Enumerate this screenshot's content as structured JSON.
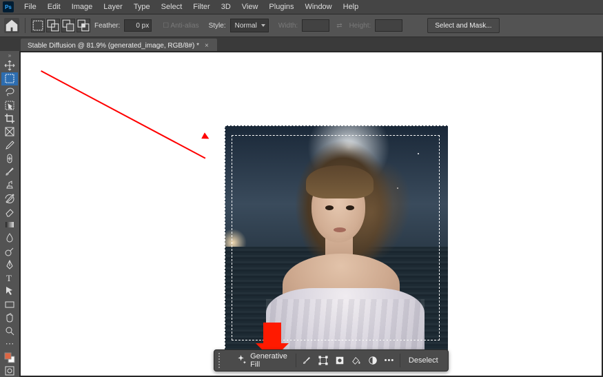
{
  "menubar": {
    "items": [
      "File",
      "Edit",
      "Image",
      "Layer",
      "Type",
      "Select",
      "Filter",
      "3D",
      "View",
      "Plugins",
      "Window",
      "Help"
    ]
  },
  "optbar": {
    "feather_label": "Feather:",
    "feather_value": "0 px",
    "antialias_label": "Anti-alias",
    "style_label": "Style:",
    "style_value": "Normal",
    "width_label": "Width:",
    "height_label": "Height:",
    "select_mask_label": "Select and Mask..."
  },
  "tab": {
    "title": "Stable Diffusion @ 81.9% (generated_image, RGB/8#) *"
  },
  "ctx": {
    "genfill": "Generative Fill",
    "deselect": "Deselect"
  },
  "icons": {
    "home": "home-icon",
    "new": "new-selection-icon",
    "add": "add-selection-icon",
    "sub": "subtract-selection-icon",
    "intersect": "intersect-selection-icon",
    "swap": "swap-dim-icon",
    "sparkle": "sparkle-icon",
    "brush": "brush-icon",
    "transform": "transform-icon",
    "mask": "mask-icon",
    "fill": "fill-icon",
    "adjust": "adjust-icon",
    "more": "more-icon"
  },
  "tools": [
    "move-tool",
    "marquee-tool",
    "lasso-tool",
    "magic-wand-tool",
    "crop-tool",
    "frame-tool",
    "eyedropper-tool",
    "spot-heal-tool",
    "brush-tool",
    "clone-stamp-tool",
    "history-brush-tool",
    "eraser-tool",
    "gradient-tool",
    "blur-tool",
    "dodge-tool",
    "pen-tool",
    "type-tool",
    "path-select-tool",
    "rectangle-tool",
    "hand-tool",
    "zoom-tool",
    "edit-toolbar",
    "fg-bg-colors",
    "quickmask-tool"
  ]
}
